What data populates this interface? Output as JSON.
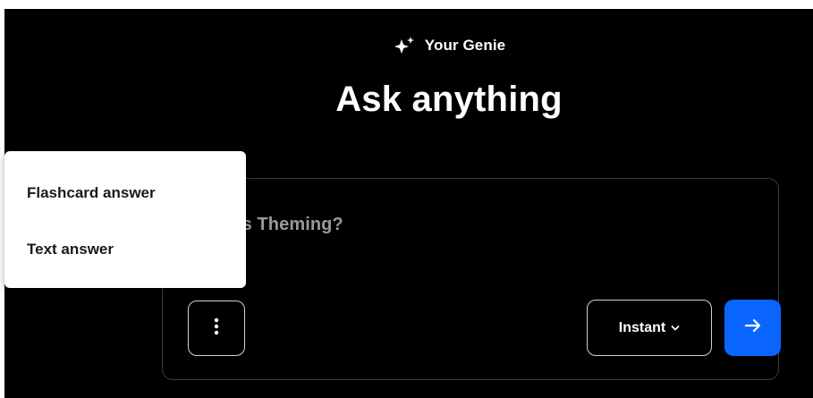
{
  "header": {
    "brand_label": "Your Genie",
    "brand_icon": "sparkles-icon",
    "title": "Ask anything"
  },
  "composer": {
    "question_text": "What is Theming?",
    "more_icon": "more-vertical-icon",
    "mode_label": "Instant",
    "mode_icon": "chevron-down-icon",
    "send_icon": "arrow-right-icon"
  },
  "menu": {
    "items": [
      {
        "label": "Flashcard answer"
      },
      {
        "label": "Text answer"
      }
    ]
  },
  "colors": {
    "background": "#000000",
    "accent": "#0a66ff",
    "menu_bg": "#ffffff",
    "placeholder": "#9a9a9a"
  }
}
